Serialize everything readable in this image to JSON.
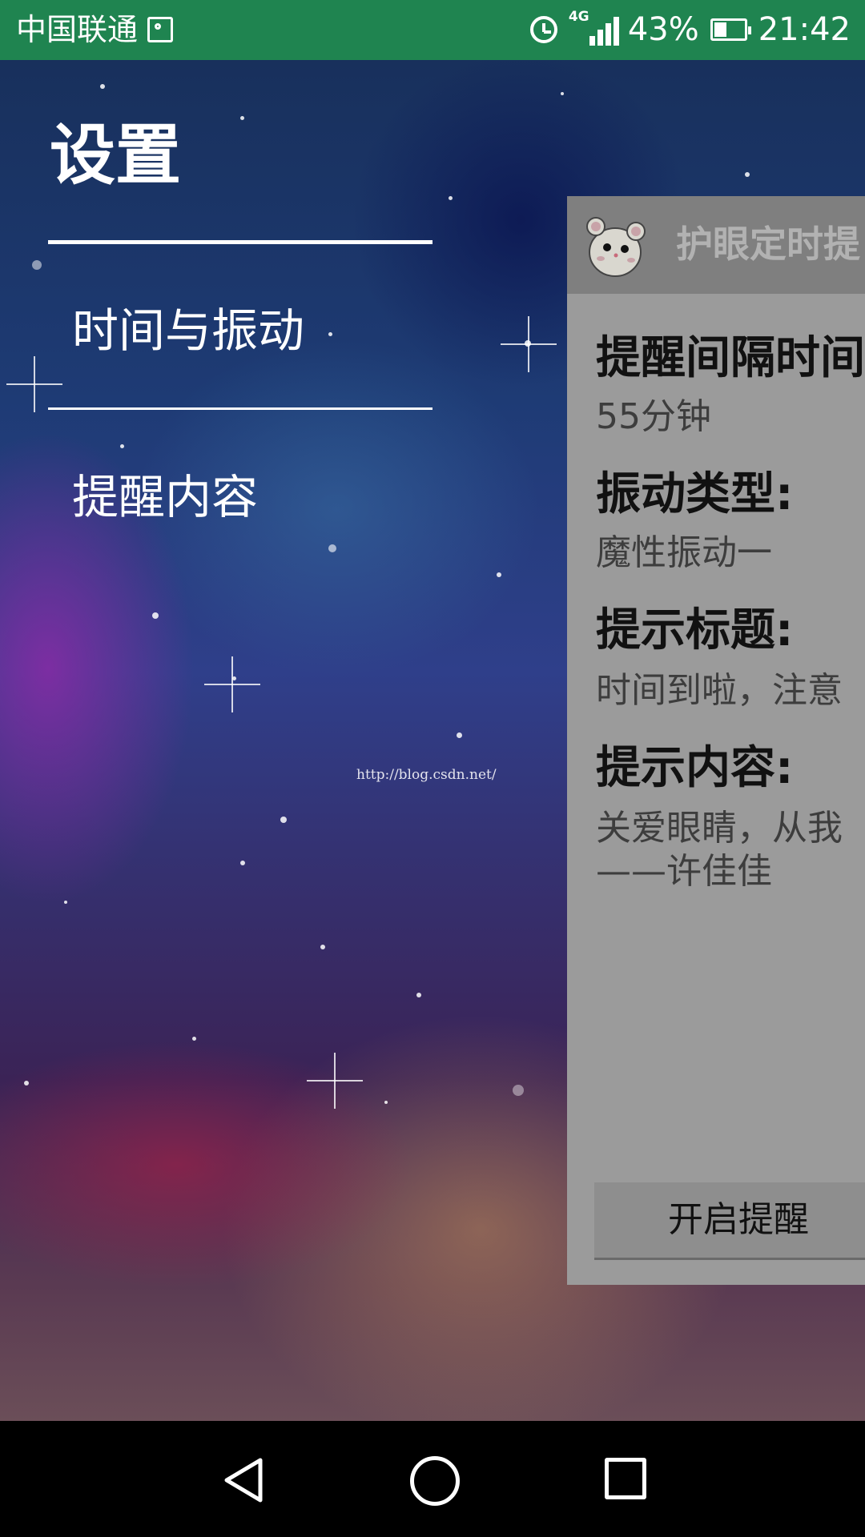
{
  "status_bar": {
    "carrier": "中国联通",
    "network_type": "4G",
    "battery_percent": "43%",
    "battery_level": 0.43,
    "time": "21:42",
    "icons": [
      "image-icon",
      "alarm-icon",
      "signal-icon",
      "battery-icon"
    ]
  },
  "drawer": {
    "title": "设置",
    "items": [
      {
        "label": "时间与振动"
      },
      {
        "label": "提醒内容"
      }
    ]
  },
  "watermark": "http://blog.csdn.net/",
  "app": {
    "title": "护眼定时提",
    "fields": [
      {
        "label": "提醒间隔时间",
        "value": "55分钟"
      },
      {
        "label": "振动类型:",
        "value": "魔性振动一"
      },
      {
        "label": "提示标题:",
        "value": "时间到啦，注意"
      },
      {
        "label": "提示内容:",
        "value": "关爱眼睛，从我",
        "value_line2": "——许佳佳"
      }
    ],
    "start_button": "开启提醒"
  },
  "colors": {
    "status_bar": "#1f8450",
    "app_overlay": "#9b9b9b",
    "app_bar": "#7f7f7f"
  }
}
